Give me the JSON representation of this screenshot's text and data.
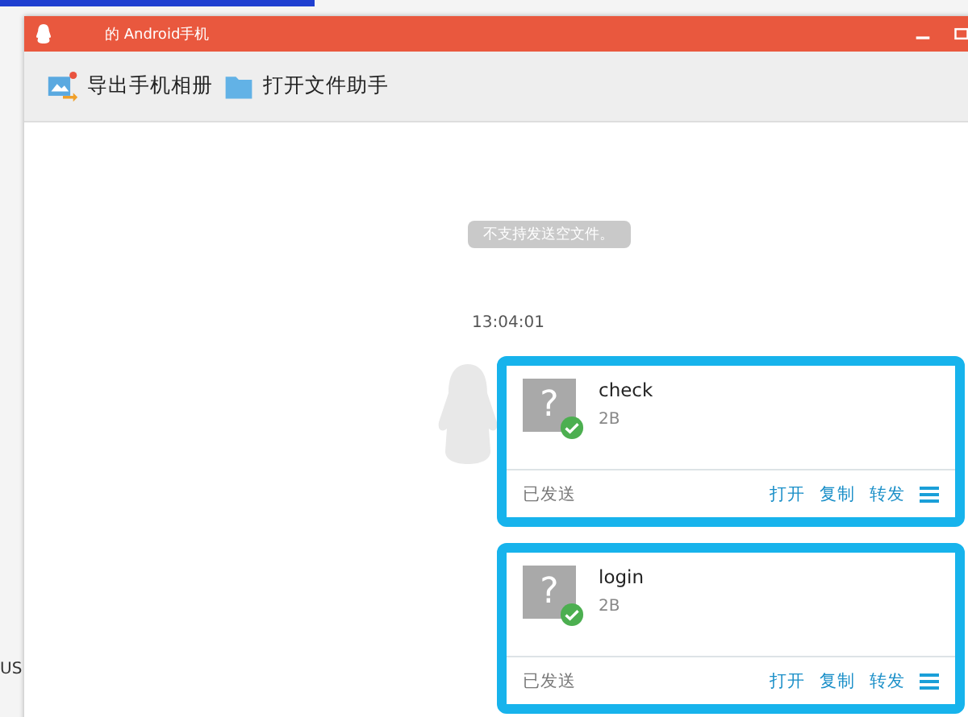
{
  "window": {
    "title": "的 Android手机"
  },
  "background": {
    "text": "US"
  },
  "toolbar": [
    {
      "label": "导出手机相册",
      "kind": "album"
    },
    {
      "label": "打开文件助手",
      "kind": "folder"
    }
  ],
  "chat": {
    "notice": "不支持发送空文件。",
    "time": "13:04:01",
    "messages": [
      {
        "name": "check",
        "size": "2B",
        "file_icon": "?",
        "sent": true,
        "status": "已发送",
        "actions": [
          "打开",
          "复制",
          "转发"
        ]
      },
      {
        "name": "login",
        "size": "2B",
        "file_icon": "?",
        "sent": true,
        "status": "已发送",
        "actions": [
          "打开",
          "复制",
          "转发"
        ]
      }
    ]
  }
}
